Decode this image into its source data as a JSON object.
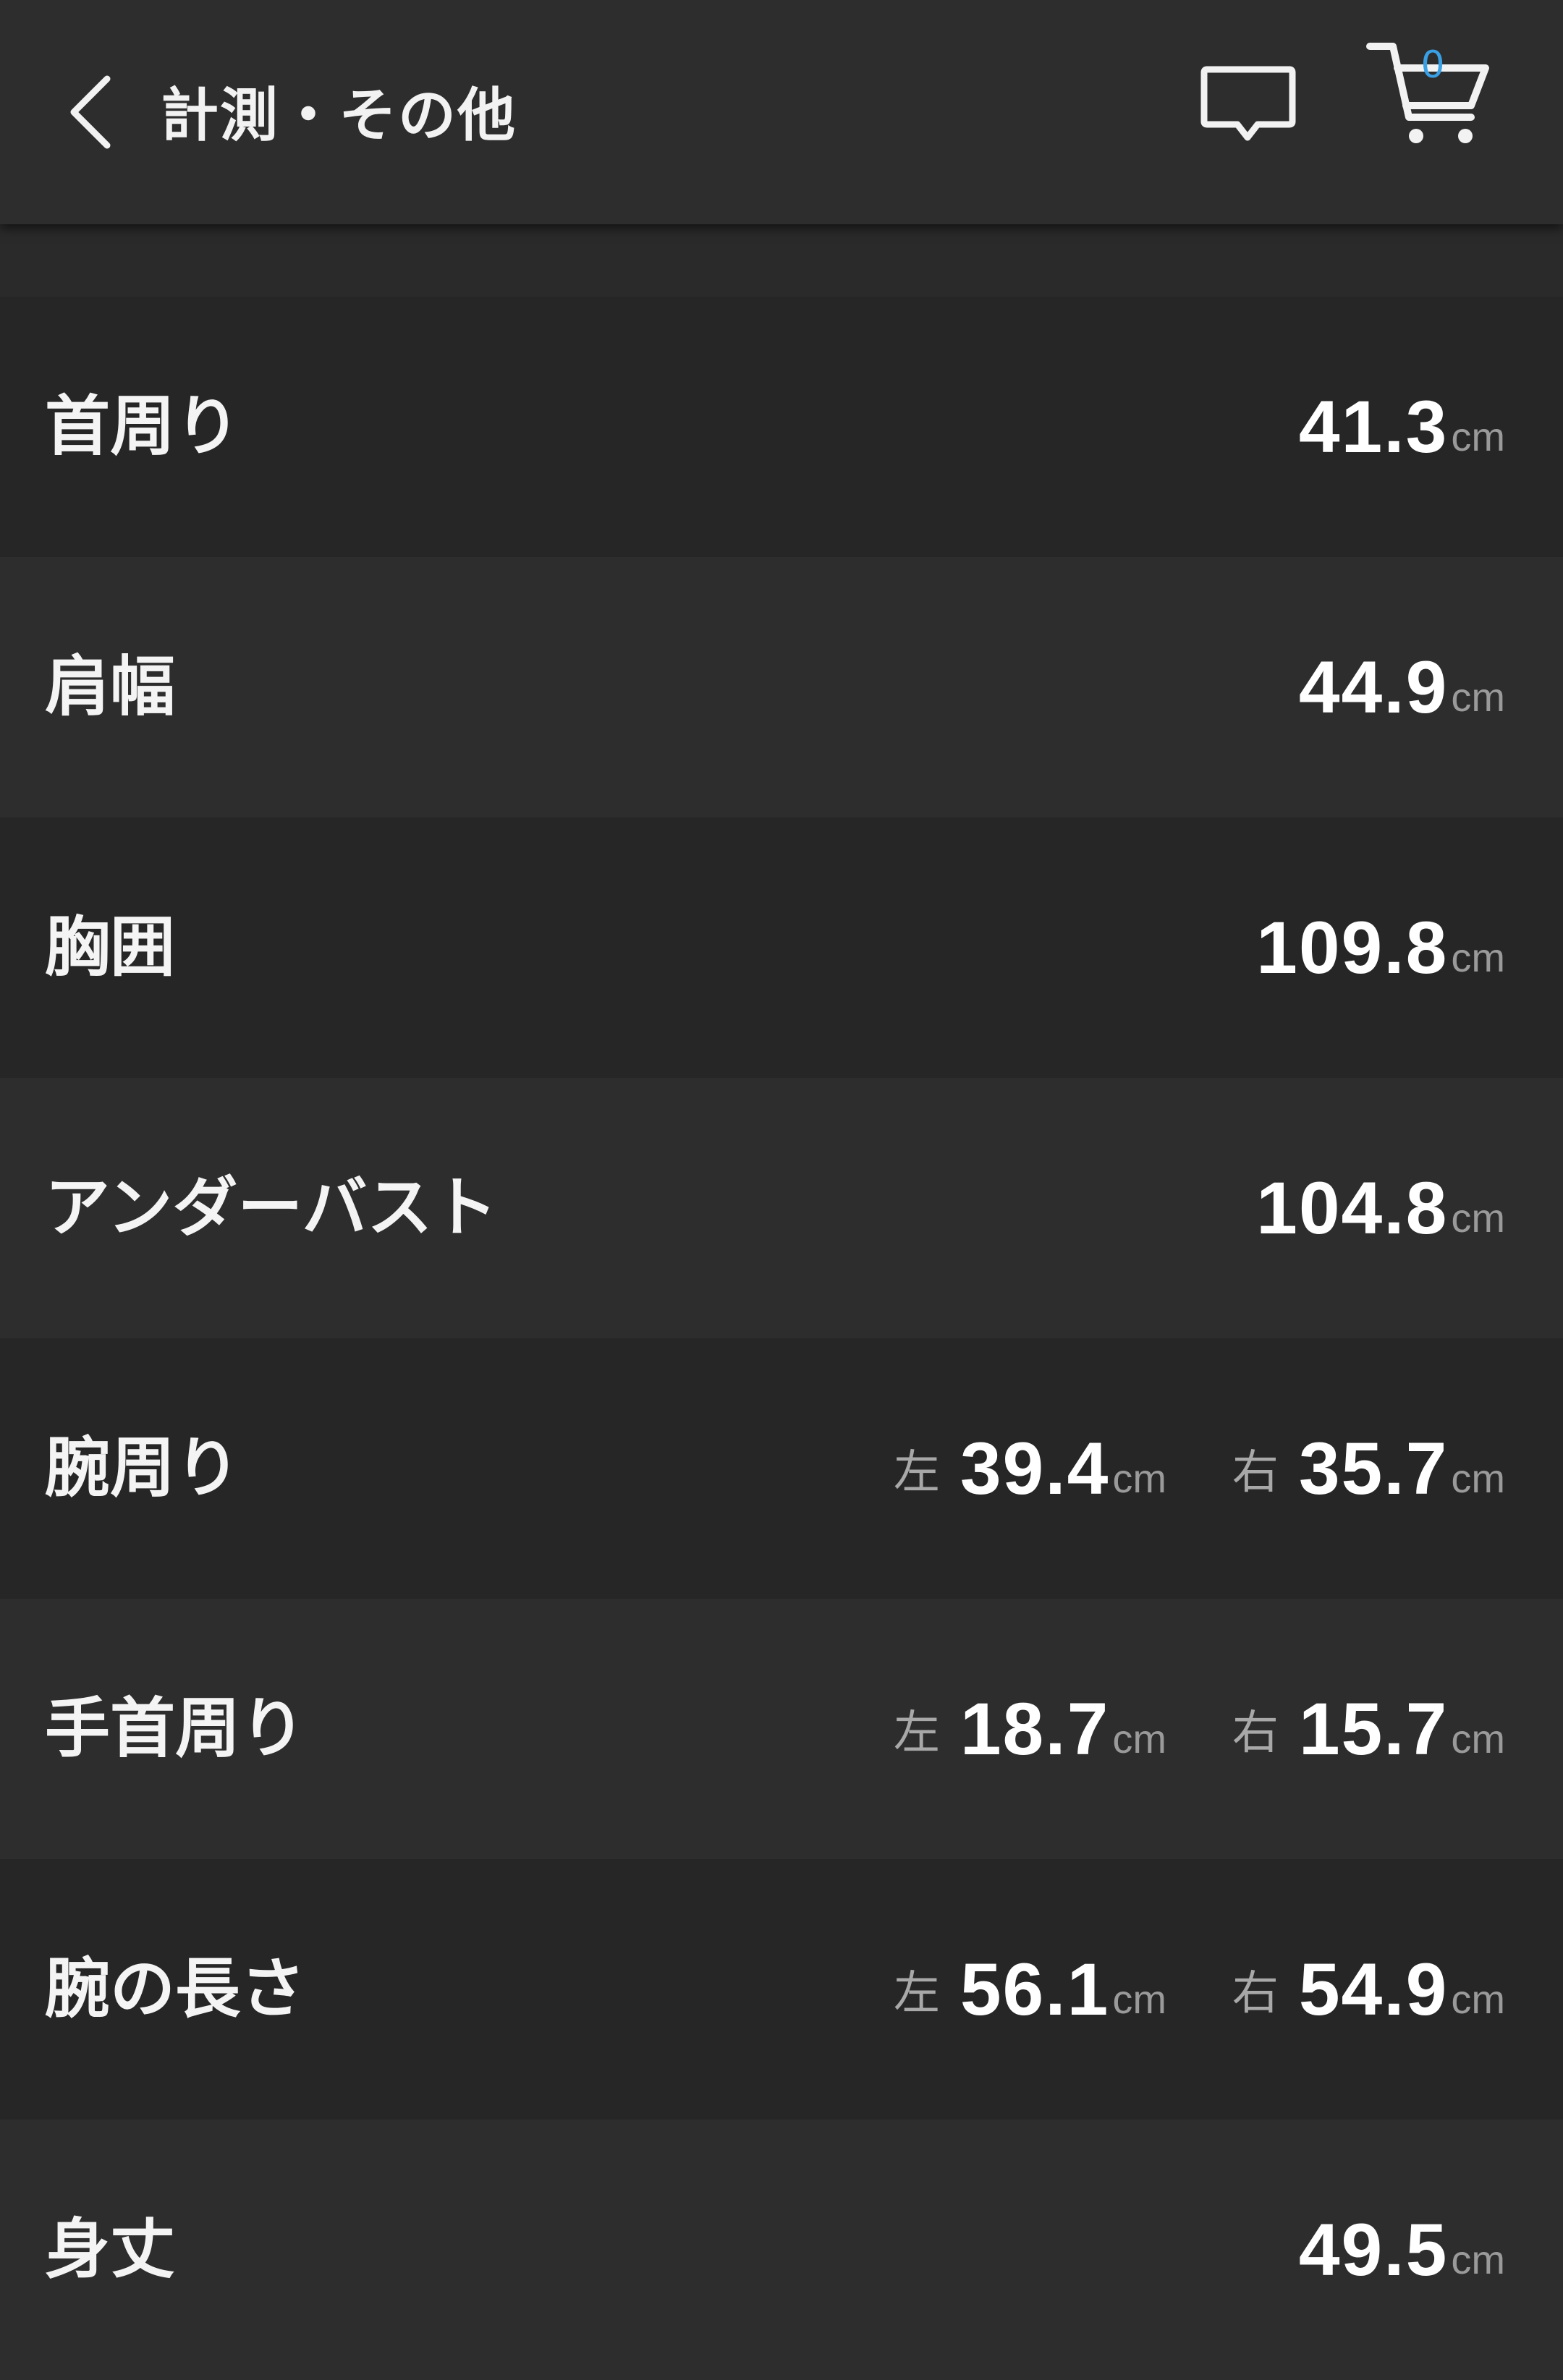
{
  "header": {
    "title": "計測・その他",
    "cart_count": "0",
    "accent_color": "#3aa0e6"
  },
  "measurements": [
    {
      "label": "首周り",
      "value": "41.3",
      "unit": "cm"
    },
    {
      "label": "肩幅",
      "value": "44.9",
      "unit": "cm"
    },
    {
      "label": "胸囲",
      "value": "109.8",
      "unit": "cm"
    },
    {
      "label": "アンダーバスト",
      "value": "104.8",
      "unit": "cm"
    },
    {
      "label": "腕周り",
      "left_label": "左",
      "left_value": "39.4",
      "right_label": "右",
      "right_value": "35.7",
      "unit": "cm"
    },
    {
      "label": "手首周り",
      "left_label": "左",
      "left_value": "18.7",
      "right_label": "右",
      "right_value": "15.7",
      "unit": "cm"
    },
    {
      "label": "腕の長さ",
      "left_label": "左",
      "left_value": "56.1",
      "right_label": "右",
      "right_value": "54.9",
      "unit": "cm"
    },
    {
      "label": "身丈",
      "value": "49.5",
      "unit": "cm"
    }
  ]
}
